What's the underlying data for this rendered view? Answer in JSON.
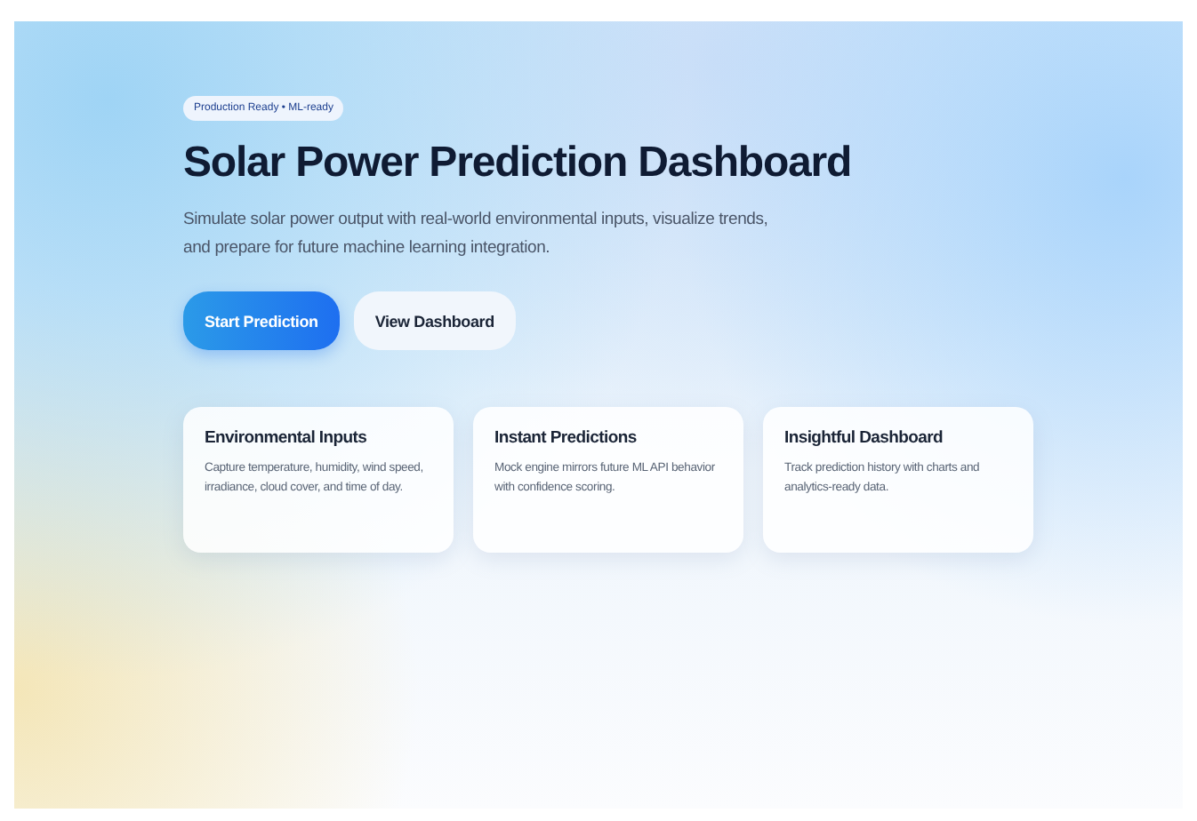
{
  "hero": {
    "badge": "Production Ready • ML-ready",
    "title": "Solar Power Prediction Dashboard",
    "subtitle": "Simulate solar power output with real-world environmental inputs, visualize trends, and prepare for future machine learning integration.",
    "buttons": [
      {
        "label": "Start Prediction",
        "kind": "primary"
      },
      {
        "label": "View Dashboard",
        "kind": "secondary"
      }
    ]
  },
  "features": [
    {
      "title": "Environmental Inputs",
      "description": "Capture temperature, humidity, wind speed, irradiance, cloud cover, and time of day."
    },
    {
      "title": "Instant Predictions",
      "description": "Mock engine mirrors future ML API behavior with confidence scoring."
    },
    {
      "title": "Insightful Dashboard",
      "description": "Track prediction history with charts and analytics-ready data."
    }
  ]
}
